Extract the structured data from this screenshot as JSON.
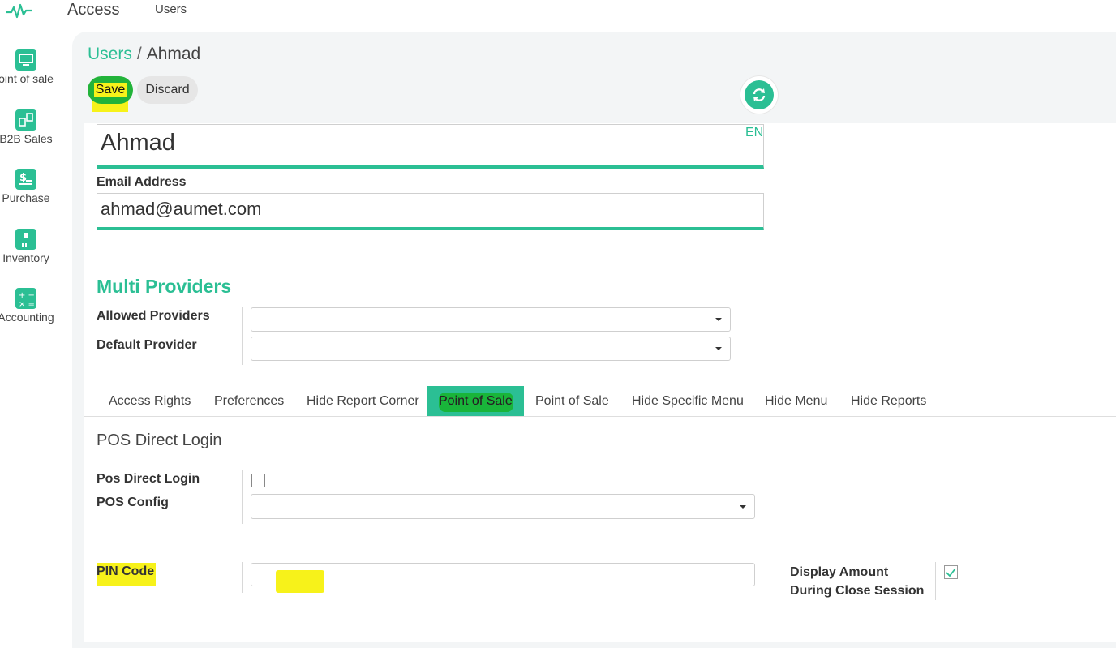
{
  "topbar": {
    "app_title": "Access",
    "menu_users": "Users"
  },
  "sidebar": {
    "items": [
      {
        "label": "oint of sale",
        "icon": "monitor-icon"
      },
      {
        "label": "B2B Sales",
        "icon": "b2b-icon"
      },
      {
        "label": "Purchase",
        "icon": "dollar-doc-icon"
      },
      {
        "label": "Inventory",
        "icon": "box-icon"
      },
      {
        "label": "Accounting",
        "icon": "calculator-icon"
      }
    ]
  },
  "breadcrumb": {
    "parent": "Users",
    "separator": "/",
    "current": "Ahmad"
  },
  "actions": {
    "save": "Save",
    "discard": "Discard"
  },
  "form": {
    "name_value": "Ahmad",
    "lang_badge": "EN",
    "email_label": "Email Address",
    "email_value": "ahmad@aumet.com"
  },
  "multi_providers": {
    "title": "Multi Providers",
    "allowed_label": "Allowed Providers",
    "allowed_value": "",
    "default_label": "Default Provider",
    "default_value": ""
  },
  "tabs": [
    "Access Rights",
    "Preferences",
    "Hide Report Corner",
    "Point of Sale",
    "Point of Sale",
    "Hide Specific Menu",
    "Hide Menu",
    "Hide Reports"
  ],
  "active_tab_index": 3,
  "pos": {
    "section_title": "POS Direct Login",
    "direct_login_label": "Pos Direct Login",
    "direct_login_checked": false,
    "config_label": "POS Config",
    "config_value": "",
    "pin_label": "PIN Code",
    "pin_value": "",
    "display_amount_label": "Display Amount During Close Session",
    "display_amount_checked": true
  },
  "colors": {
    "accent": "#2bbf94",
    "highlight": "#f7f21a",
    "marker_green": "#19b53a"
  }
}
